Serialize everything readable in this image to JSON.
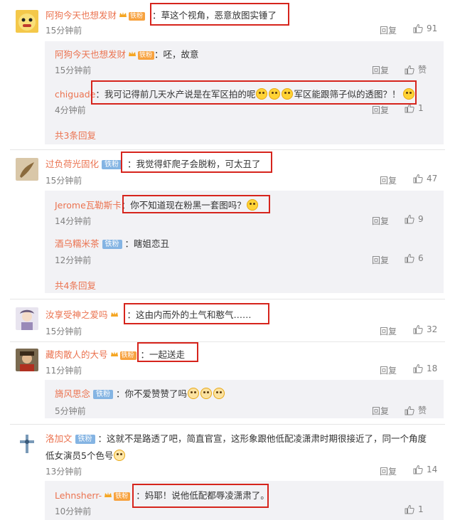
{
  "reply_label": "回复",
  "like_label": "赞",
  "colors": {
    "username": "#eb7350",
    "highlight_box": "#d6241c",
    "sub_background": "#f2f2f5",
    "fan_badge": "#f7a23f",
    "iron_badge": "#84b4e3"
  },
  "comments": [
    {
      "user": "阿狗今天也想发财",
      "badge": "铁粉",
      "text": "：草这个视角，恶意放图实锤了",
      "time": "15分钟前",
      "likes": "91",
      "replies": [
        {
          "user": "阿狗今天也想发财",
          "badge": "铁粉",
          "text": "：呸，故意",
          "time": "15分钟前",
          "likes": "赞"
        },
        {
          "user": "chiguade",
          "text_a": "：我可记得前几天水产说是在军区拍的呢",
          "text_b": "军区能跟筛子似的透图？！",
          "time": "4分钟前",
          "likes": "1"
        }
      ],
      "more": "共3条回复"
    },
    {
      "user": "过负荷光固化",
      "badge": "铁粉",
      "text": "：我觉得虾爬子会脱粉，可太丑了",
      "time": "15分钟前",
      "likes": "47",
      "replies": [
        {
          "user": "Jerome瓦勒斯卡",
          "text": "：你不知道现在粉黑一套图吗？",
          "time": "14分钟前",
          "likes": "9"
        },
        {
          "user": "酒乌糯米茶",
          "badge": "铁粉",
          "text": "：瞎姐恋丑",
          "time": "12分钟前",
          "likes": "6"
        }
      ],
      "more": "共4条回复"
    },
    {
      "user": "汝享受神之爱吗",
      "text": "：这由内而外的土气和憨气……",
      "time": "15分钟前",
      "likes": "32"
    },
    {
      "user": "藏肉散人的大号",
      "badge": "铁粉",
      "text": "：一起送走",
      "time": "11分钟前",
      "likes": "18",
      "replies": [
        {
          "user": "旖风思念",
          "badge": "铁粉",
          "text": "：你不爱赞赞了吗",
          "time": "5分钟前",
          "likes": "赞"
        }
      ]
    },
    {
      "user": "洛加文",
      "badge": "铁粉",
      "text_line1": "：这就不是路透了吧，简直官宣，这形象跟他低配凌潇肃时期很接近了，同一个角度",
      "text_line2": "低女演员5个色号",
      "time": "13分钟前",
      "likes": "14",
      "replies": [
        {
          "user": "Lehnsherr-",
          "badge": "铁粉",
          "text": "：妈耶！说他低配都辱凌潇肃了。",
          "time": "10分钟前",
          "likes": "1"
        }
      ]
    }
  ]
}
